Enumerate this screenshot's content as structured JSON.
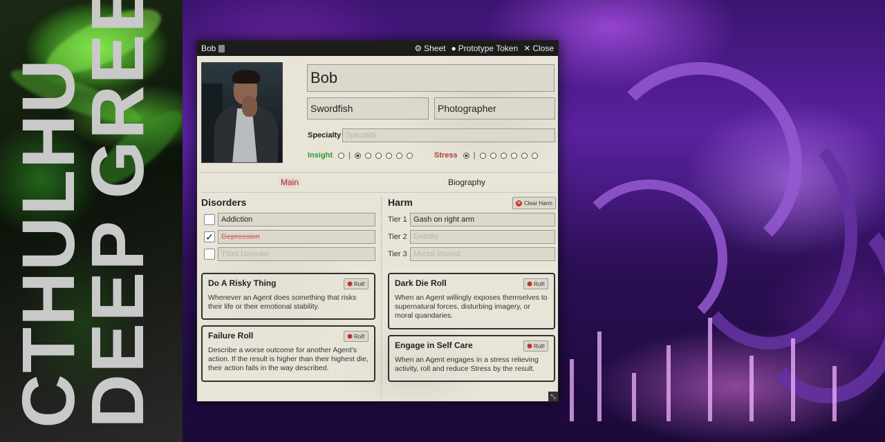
{
  "banner": {
    "line1": "CTHULHU",
    "line2": "DEEP GREEN"
  },
  "window": {
    "title": "Bob",
    "sheet_label": "Sheet",
    "token_label": "Prototype Token",
    "close_label": "Close"
  },
  "character": {
    "name": "Bob",
    "codename": "Swordfish",
    "occupation": "Photographer",
    "specialty_label": "Specialty",
    "specialty_placeholder": "Specialty",
    "insight_label": "Insight",
    "insight_value": 1,
    "stress_label": "Stress",
    "stress_value": 0
  },
  "tabs": [
    {
      "label": "Main",
      "active": true
    },
    {
      "label": "Biography",
      "active": false
    }
  ],
  "disorders": {
    "title": "Disorders",
    "items": [
      {
        "value": "Addiction",
        "checked": false,
        "placeholder": false
      },
      {
        "value": "Depression",
        "checked": true,
        "placeholder": false
      },
      {
        "value": "Third Disorder",
        "checked": false,
        "placeholder": true
      }
    ]
  },
  "harm": {
    "title": "Harm",
    "clear_label": "Clear Harm",
    "tiers": [
      {
        "label": "Tier 1",
        "value": "Gash on right arm",
        "placeholder": false
      },
      {
        "label": "Tier 2",
        "value": "Debility",
        "placeholder": true
      },
      {
        "label": "Tier 3",
        "value": "Mortal Wound",
        "placeholder": true
      }
    ]
  },
  "roll_label": "Roll!",
  "cards": [
    {
      "title": "Do A Risky Thing",
      "desc": "Whenever an Agent does something that risks their life or their emotional stability."
    },
    {
      "title": "Failure Roll",
      "desc": "Describe a worse outcome for another Agent's action. If the result is higher than their highest die, their action fails in the way described."
    },
    {
      "title": "Dark Die Roll",
      "desc": "When an Agent willingly exposes themselves to supernatural forces, disturbing imagery, or moral quandaries."
    },
    {
      "title": "Engage in Self Care",
      "desc": "When an Agent engages in a stress relieving activity, roll and reduce Stress by the result."
    }
  ],
  "colors": {
    "insight": "#2e9b2e",
    "stress": "#b53a3a",
    "active_tab": "#aa3333"
  },
  "icons": {
    "sheet": "gear-icon",
    "token": "user-circle-icon",
    "close": "close-icon",
    "clear": "x-circle-icon",
    "roll": "dice-icon",
    "resize": "resize-icon"
  }
}
